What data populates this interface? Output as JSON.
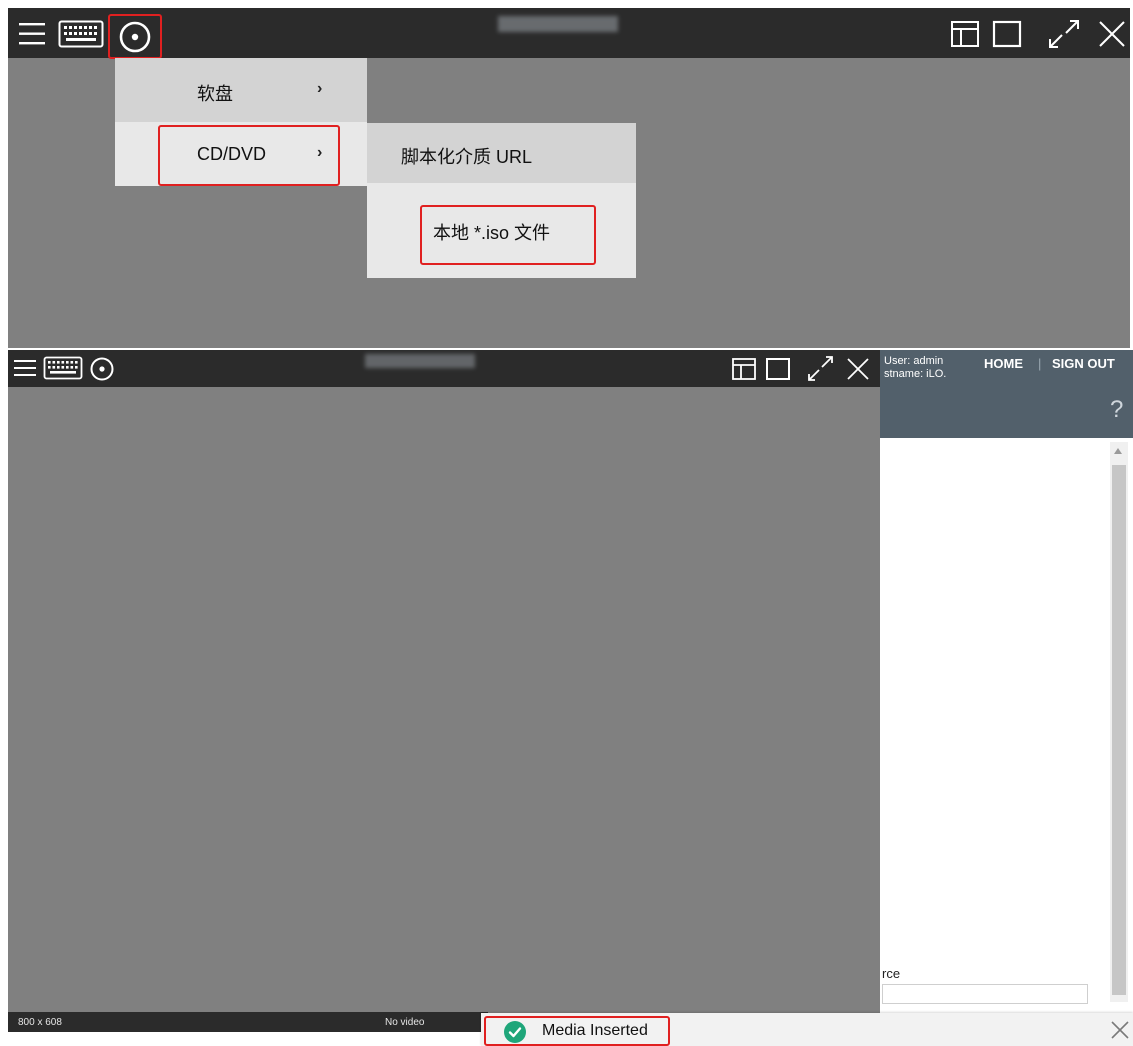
{
  "top_console": {
    "toolbar": {
      "icons": [
        "menu-icon",
        "keyboard-icon",
        "virtual-media-icon",
        "window-layout-icon",
        "maximize-icon",
        "fullscreen-icon",
        "close-icon"
      ]
    },
    "menu": {
      "floppy_label": "软盘",
      "cd_label": "CD/DVD",
      "chevron": "›",
      "submenu": {
        "url_label": "脚本化介质 URL",
        "iso_label": "本地 *.iso 文件"
      }
    }
  },
  "inner_console": {
    "toolbar": {
      "icons": [
        "menu-icon",
        "keyboard-icon",
        "virtual-media-icon",
        "window-layout-icon",
        "maximize-icon",
        "fullscreen-icon",
        "close-icon"
      ]
    },
    "status": {
      "resolution": "800 x 608",
      "video": "No video"
    }
  },
  "right_panel": {
    "user_line": "User: admin",
    "host_line": "stname: iLO.",
    "home_label": "HOME",
    "separator": "|",
    "signout_label": "SIGN OUT",
    "help_label": "?",
    "partial_text": "rce"
  },
  "toast": {
    "message": "Media Inserted",
    "icon": "check-circle-icon",
    "close_icon": "close-icon"
  },
  "colors": {
    "console_gray": "#808080",
    "toolbar_dark": "#2b2b2b",
    "highlight_red": "#e02020",
    "panel_slate": "#52606b",
    "success_green": "#1fa67a"
  }
}
